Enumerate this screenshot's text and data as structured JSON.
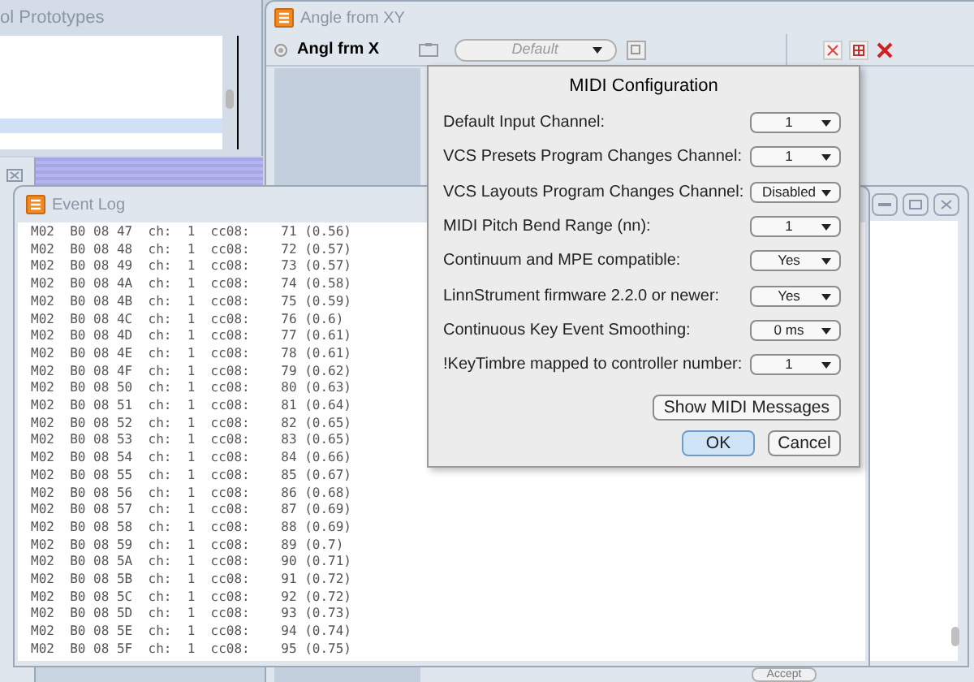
{
  "back_window": {
    "title": "ol Prototypes"
  },
  "angle_window": {
    "title": "Angle from XY",
    "name": "Angl frm X",
    "preset": "Default"
  },
  "midi_dialog": {
    "title": "MIDI Configuration",
    "settings": [
      {
        "label": "Default Input Channel:",
        "value": "1"
      },
      {
        "label": "VCS Presets Program Changes Channel:",
        "value": "1"
      },
      {
        "label": "VCS Layouts Program Changes Channel:",
        "value": "Disabled"
      },
      {
        "label": "MIDI Pitch Bend Range (nn):",
        "value": "1"
      },
      {
        "label": "Continuum and MPE compatible:",
        "value": "Yes"
      },
      {
        "label": "LinnStrument firmware 2.2.0 or newer:",
        "value": "Yes"
      },
      {
        "label": "Continuous Key Event Smoothing:",
        "value": "0 ms"
      },
      {
        "label": "!KeyTimbre mapped to controller number:",
        "value": "1"
      }
    ],
    "buttons": [
      {
        "label": "Show MIDI Messages",
        "kind": "wide"
      },
      {
        "label": "OK",
        "kind": "default"
      },
      {
        "label": "Cancel",
        "kind": "normal"
      }
    ]
  },
  "event_log": {
    "title": "Event Log",
    "lines": [
      "M02  B0 08 47  ch:  1  cc08:    71 (0.56)",
      "M02  B0 08 48  ch:  1  cc08:    72 (0.57)",
      "M02  B0 08 49  ch:  1  cc08:    73 (0.57)",
      "M02  B0 08 4A  ch:  1  cc08:    74 (0.58)",
      "M02  B0 08 4B  ch:  1  cc08:    75 (0.59)",
      "M02  B0 08 4C  ch:  1  cc08:    76 (0.6)",
      "M02  B0 08 4D  ch:  1  cc08:    77 (0.61)",
      "M02  B0 08 4E  ch:  1  cc08:    78 (0.61)",
      "M02  B0 08 4F  ch:  1  cc08:    79 (0.62)",
      "M02  B0 08 50  ch:  1  cc08:    80 (0.63)",
      "M02  B0 08 51  ch:  1  cc08:    81 (0.64)",
      "M02  B0 08 52  ch:  1  cc08:    82 (0.65)",
      "M02  B0 08 53  ch:  1  cc08:    83 (0.65)",
      "M02  B0 08 54  ch:  1  cc08:    84 (0.66)",
      "M02  B0 08 55  ch:  1  cc08:    85 (0.67)",
      "M02  B0 08 56  ch:  1  cc08:    86 (0.68)",
      "M02  B0 08 57  ch:  1  cc08:    87 (0.69)",
      "M02  B0 08 58  ch:  1  cc08:    88 (0.69)",
      "M02  B0 08 59  ch:  1  cc08:    89 (0.7)",
      "M02  B0 08 5A  ch:  1  cc08:    90 (0.71)",
      "M02  B0 08 5B  ch:  1  cc08:    91 (0.72)",
      "M02  B0 08 5C  ch:  1  cc08:    92 (0.72)",
      "M02  B0 08 5D  ch:  1  cc08:    93 (0.73)",
      "M02  B0 08 5E  ch:  1  cc08:    94 (0.74)",
      "M02  B0 08 5F  ch:  1  cc08:    95 (0.75)"
    ]
  },
  "bottom_button": {
    "label": "Accept"
  }
}
